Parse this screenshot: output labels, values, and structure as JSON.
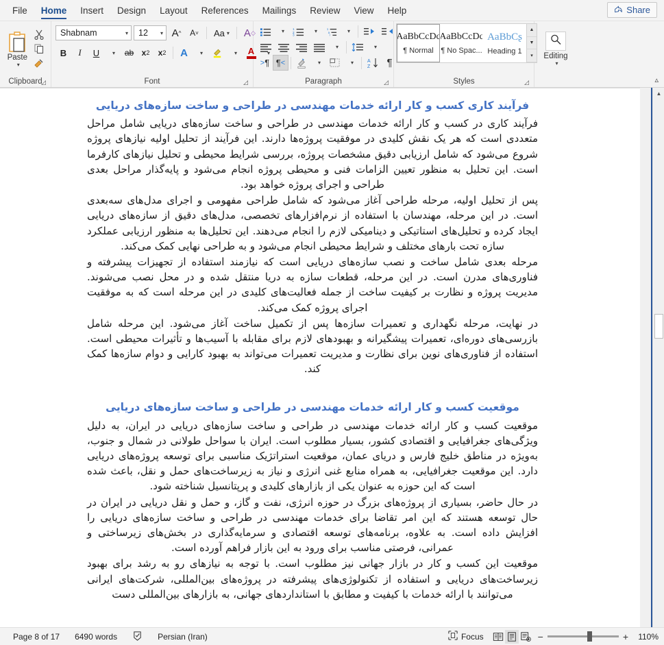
{
  "window": {
    "tabs": [
      {
        "label": "File",
        "active": false
      },
      {
        "label": "Home",
        "active": true
      },
      {
        "label": "Insert",
        "active": false
      },
      {
        "label": "Design",
        "active": false
      },
      {
        "label": "Layout",
        "active": false
      },
      {
        "label": "References",
        "active": false
      },
      {
        "label": "Mailings",
        "active": false
      },
      {
        "label": "Review",
        "active": false
      },
      {
        "label": "View",
        "active": false
      },
      {
        "label": "Help",
        "active": false
      }
    ],
    "share_label": "Share"
  },
  "ribbon": {
    "clipboard": {
      "group_label": "Clipboard",
      "paste_label": "Paste",
      "cut_label": "Cut",
      "copy_label": "Copy",
      "format_painter_label": "Format Painter"
    },
    "font": {
      "group_label": "Font",
      "font_name": "Shabnam",
      "font_size": "12",
      "grow_font_label": "A",
      "shrink_font_label": "A",
      "change_case_label": "Aa",
      "clear_formatting_label": "A",
      "bold_label": "B",
      "italic_label": "I",
      "underline_label": "U",
      "strikethrough_label": "ab",
      "subscript_label": "x",
      "superscript_label": "x",
      "text_effects_label": "A",
      "highlight_label": "A",
      "font_color_label": "A"
    },
    "paragraph": {
      "group_label": "Paragraph",
      "bullets_label": "Bullets",
      "numbering_label": "Numbering",
      "multilevel_label": "Multilevel List",
      "decrease_indent_label": "Decrease Indent",
      "increase_indent_label": "Increase Indent",
      "align_left_label": "Align Left",
      "align_center_label": "Center",
      "align_right_label": "Align Right",
      "justify_label": "Justify",
      "line_spacing_label": "Line and Paragraph Spacing",
      "ltr_label": "Left-to-Right Text Direction",
      "rtl_label": "Right-to-Left Text Direction",
      "shading_label": "Shading",
      "borders_label": "Borders",
      "sort_label": "Sort",
      "show_marks_label": "Show/Hide Formatting Marks"
    },
    "styles": {
      "group_label": "Styles",
      "items": [
        {
          "preview": "AaBbCcDc",
          "name": "¶ Normal",
          "selected": true
        },
        {
          "preview": "AaBbCcDc",
          "name": "¶ No Spac...",
          "selected": false
        },
        {
          "preview": "AaBbCʂ",
          "name": "Heading 1",
          "selected": false
        }
      ]
    },
    "editing": {
      "group_label": "",
      "label": "Editing"
    }
  },
  "document": {
    "blocks": [
      {
        "type": "heading",
        "text": "فرآیند کاری کسب و کار ارائه خدمات مهندسی در طراحی و ساخت سازه‌های دریایی"
      },
      {
        "type": "paragraph",
        "text": "فرآیند کاری در کسب و کار ارائه خدمات مهندسی در طراحی و ساخت سازه‌های دریایی شامل مراحل متعددی است که هر یک نقش کلیدی در موفقیت پروژه‌ها دارند. این فرآیند از تحلیل اولیه نیازهای پروژه شروع می‌شود که شامل ارزیابی دقیق مشخصات پروژه، بررسی شرایط محیطی و تحلیل نیازهای کارفرما است. این تحلیل به منظور تعیین الزامات فنی و محیطی پروژه انجام می‌شود و پایه‌گذار مراحل بعدی طراحی و اجرای پروژه خواهد بود."
      },
      {
        "type": "paragraph",
        "text": "پس از تحلیل اولیه، مرحله طراحی آغاز می‌شود که شامل طراحی مفهومی و اجرای مدل‌های سه‌بعدی است. در این مرحله، مهندسان با استفاده از نرم‌افزارهای تخصصی، مدل‌های دقیق از سازه‌های دریایی ایجاد کرده و تحلیل‌های استاتیکی و دینامیکی لازم را انجام می‌دهند. این تحلیل‌ها به منظور ارزیابی عملکرد سازه تحت بارهای مختلف و شرایط محیطی انجام می‌شود و به طراحی نهایی کمک می‌کند."
      },
      {
        "type": "paragraph",
        "text": "مرحله بعدی شامل ساخت و نصب سازه‌های دریایی است که نیازمند استفاده از تجهیزات پیشرفته و فناوری‌های مدرن است. در این مرحله، قطعات سازه به دریا منتقل شده و در محل نصب می‌شوند. مدیریت پروژه و نظارت بر کیفیت ساخت از جمله فعالیت‌های کلیدی در این مرحله است که به موفقیت اجرای پروژه کمک می‌کند."
      },
      {
        "type": "paragraph",
        "text": "در نهایت، مرحله نگهداری و تعمیرات سازه‌ها پس از تکمیل ساخت آغاز می‌شود. این مرحله شامل بازرسی‌های دوره‌ای، تعمیرات پیشگیرانه و بهبودهای لازم برای مقابله با آسیب‌ها و تأثیرات محیطی است. استفاده از فناوری‌های نوین برای نظارت و مدیریت تعمیرات می‌تواند به بهبود کارایی و دوام سازه‌ها کمک کند."
      },
      {
        "type": "heading",
        "text": "موقعیت کسب و کار ارائه خدمات مهندسی در طراحی و ساخت سازه‌های دریایی"
      },
      {
        "type": "paragraph",
        "text": "موقعیت کسب و کار ارائه خدمات مهندسی در طراحی و ساخت سازه‌های دریایی در ایران، به دلیل ویژگی‌های جغرافیایی و اقتصادی کشور، بسیار مطلوب است. ایران با سواحل طولانی در شمال و جنوب، به‌ویژه در مناطق خلیج فارس و دریای عمان، موقعیت استراتژیک مناسبی برای توسعه پروژه‌های دریایی دارد. این موقعیت جغرافیایی، به همراه منابع غنی انرژی و نیاز به زیرساخت‌های حمل و نقل، باعث شده است که این حوزه به عنوان یکی از بازارهای کلیدی و پرپتانسیل شناخته شود."
      },
      {
        "type": "paragraph",
        "text": "در حال حاضر، بسیاری از پروژه‌های بزرگ در حوزه انرژی، نفت و گاز، و حمل و نقل دریایی در ایران در حال توسعه هستند که این امر تقاضا برای خدمات مهندسی در طراحی و ساخت سازه‌های دریایی را افزایش داده است. به علاوه، برنامه‌های توسعه اقتصادی و سرمایه‌گذاری در بخش‌های زیرساختی و عمرانی، فرصتی مناسب برای ورود به این بازار فراهم آورده است."
      },
      {
        "type": "paragraph",
        "text": "موقعیت این کسب و کار در بازار جهانی نیز مطلوب است. با توجه به نیازهای رو به رشد برای بهبود زیرساخت‌های دریایی و استفاده از تکنولوژی‌های پیشرفته در پروژه‌های بین‌المللی، شرکت‌های ایرانی می‌توانند با ارائه خدمات با کیفیت و مطابق با استانداردهای جهانی، به بازارهای بین‌المللی دست"
      }
    ]
  },
  "statusbar": {
    "page_info": "Page 8 of 17",
    "word_count": "6490 words",
    "proofing_label": "",
    "language": "Persian (Iran)",
    "focus_label": "Focus",
    "zoom_level": "110%",
    "zoom_out_label": "−",
    "zoom_in_label": "+"
  },
  "colors": {
    "heading": "#4472c4",
    "accent": "#2b579a",
    "body_text": "#1c1c1c"
  }
}
